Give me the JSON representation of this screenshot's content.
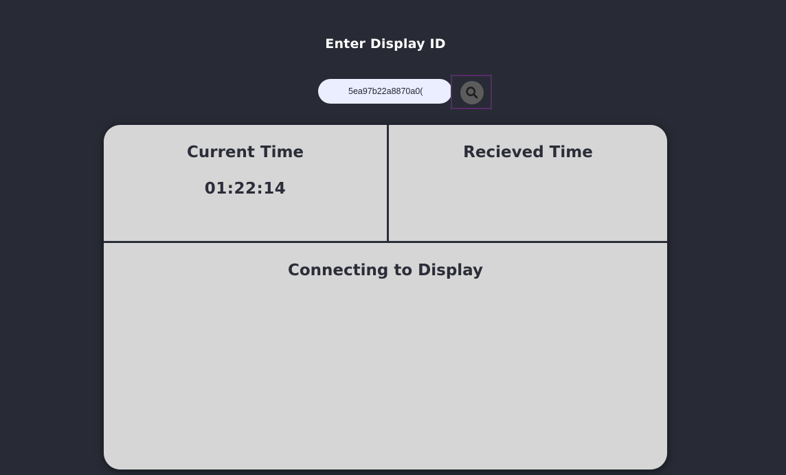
{
  "header": {
    "title": "Enter Display ID"
  },
  "search": {
    "value": "5ea97b22a8870a0(",
    "icon": "search-icon"
  },
  "panel": {
    "current_time": {
      "label": "Current Time",
      "value": "01:22:14"
    },
    "received_time": {
      "label": "Recieved Time",
      "value": ""
    },
    "status": {
      "label": "Connecting to Display"
    }
  },
  "colors": {
    "background": "#282b35",
    "panel": "#d6d6d6",
    "panel_text": "#2b2d38",
    "input_background": "#eaeefe",
    "search_button_border": "#5a2a6e",
    "search_icon_bg": "#5c5c5c"
  }
}
